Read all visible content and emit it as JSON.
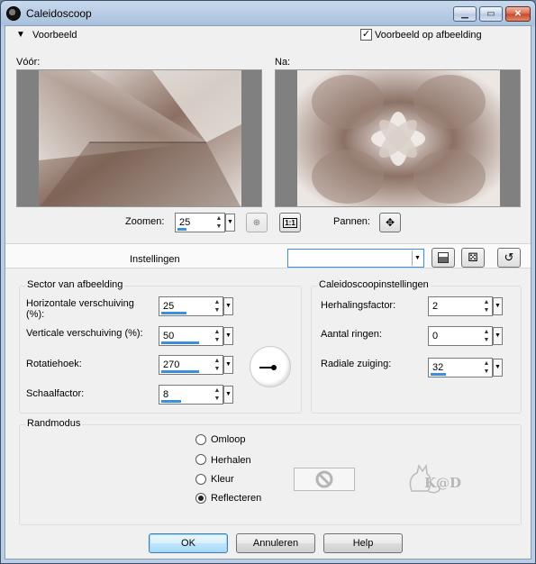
{
  "window": {
    "title": "Caleidoscoop"
  },
  "preview": {
    "toggle_label": "Voorbeeld",
    "on_image_label": "Voorbeeld op afbeelding",
    "on_image_checked": true,
    "before_label": "Vóór:",
    "after_label": "Na:"
  },
  "zoom": {
    "label": "Zoomen:",
    "value": "25",
    "percent": 0.25
  },
  "pan": {
    "label": "Pannen:"
  },
  "presets": {
    "label": "Instellingen",
    "value": ""
  },
  "sector": {
    "title": "Sector van afbeelding",
    "fields": [
      {
        "label": "Horizontale verschuiving (%):",
        "value": "25",
        "fill": 0.5
      },
      {
        "label": "Verticale verschuiving (%):",
        "value": "50",
        "fill": 0.75
      },
      {
        "label": "Rotatiehoek:",
        "value": "270",
        "fill": 0.75
      },
      {
        "label": "Schaalfactor:",
        "value": "8",
        "fill": 0.4
      }
    ]
  },
  "kaleido": {
    "title": "Caleidoscoopinstellingen",
    "fields": [
      {
        "label": "Herhalingsfactor:",
        "value": "2",
        "fill": 0.0
      },
      {
        "label": "Aantal ringen:",
        "value": "0",
        "fill": 0.0
      },
      {
        "label": "Radiale zuiging:",
        "value": "32",
        "fill": 0.3
      }
    ]
  },
  "edge": {
    "title": "Randmodus",
    "options": [
      "Omloop",
      "Herhalen",
      "Kleur",
      "Reflecteren"
    ],
    "selected": "Reflecteren"
  },
  "buttons": {
    "ok": "OK",
    "cancel": "Annuleren",
    "help": "Help"
  },
  "watermark": {
    "text": "K@D"
  }
}
